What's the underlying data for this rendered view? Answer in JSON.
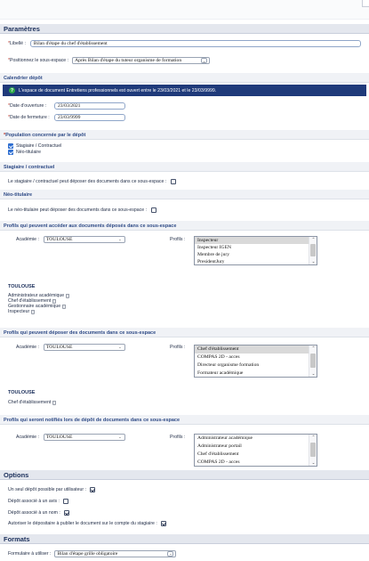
{
  "parametres": {
    "title": "Paramètres",
    "libelle_label": "Libellé :",
    "libelle_value": "Bilan d'étape du chef d'établissement",
    "position_label": "Positionnez le sous-espace :",
    "position_value": "Après Bilan d'étape du tuteur organisme de formation"
  },
  "calendrier": {
    "title": "Calendrier dépôt",
    "info": "L'espace de document Entretiens professionnels est ouvert entre le 23/03/2021 et le 23/03/9999.",
    "ouverture_label": "Date d'ouverture :",
    "ouverture_value": "23/03/2021",
    "fermeture_label": "Date de fermeture :",
    "fermeture_value": "23/03/9999"
  },
  "population": {
    "title": "Population concernée par le dépôt",
    "items": [
      "Stagiaire / Contractuel",
      "Néo-titulaire"
    ]
  },
  "stagiaire": {
    "title": "Stagiaire / contractuel",
    "text": "Le stagiaire / contractuel peut déposer des documents dans ce sous-espace :"
  },
  "neo": {
    "title": "Néo-titulaire",
    "text": "Le néo-titulaire peut déposer des documents dans ce sous-espace :"
  },
  "acceder": {
    "title": "Profils qui peuvent accéder aux documents déposés dans ce sous-espace",
    "academie_label": "Académie :",
    "academie_value": "TOULOUSE",
    "profils_label": "Profils :",
    "options": [
      "Inspecteur",
      "Inspecteur IGEN",
      "Membre de jury",
      "PresidentJury"
    ],
    "city": "TOULOUSE",
    "assigned": [
      "Administrateur académique",
      "Chef d'établissement",
      "Gestionnaire académique",
      "Inspecteur"
    ]
  },
  "deposer": {
    "title": "Profils qui peuvent déposer des documents dans ce sous-espace",
    "academie_label": "Académie :",
    "academie_value": "TOULOUSE",
    "profils_label": "Profils :",
    "options": [
      "Chef d'établissement",
      "COMPAS 2D - acces",
      "Directeur organisme formation",
      "Formateur académique"
    ],
    "city": "TOULOUSE",
    "assigned": [
      "Chef d'établissement"
    ]
  },
  "notifies": {
    "title": "Profils qui seront notifiés lors de dépôt de documents dans ce sous-espace",
    "academie_label": "Académie :",
    "academie_value": "TOULOUSE",
    "profils_label": "Profils :",
    "options": [
      "Administrateur académique",
      "Administrateur portail",
      "Chef d'établissement",
      "COMPAS 2D - acces"
    ]
  },
  "options": {
    "title": "Options",
    "items": [
      "Un seul dépôt possible par utilisateur :",
      "Dépôt associé à un avis :",
      "Dépôt associé à un nom :",
      "Autoriser le dépositaire à publier le document sur le compte du stagiaire :"
    ]
  },
  "formats": {
    "title": "Formats",
    "label": "Formulaire à utiliser :",
    "value": "Bilan d'étape grille obligatoire"
  }
}
